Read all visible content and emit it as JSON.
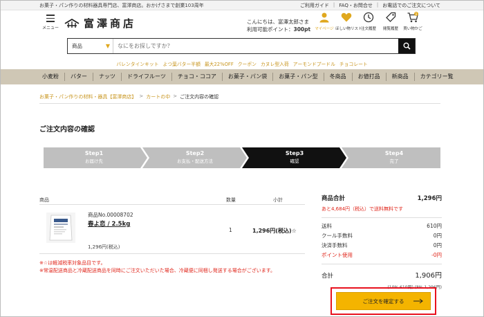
{
  "topbar": {
    "tagline": "お菓子・パン作りの材料器具専門店、富澤商店。おかげさまで創業103周年",
    "links": [
      "ご利用ガイド",
      "FAQ・お問合せ",
      "お電話でのご注文について"
    ]
  },
  "header": {
    "menu_label": "メニュー",
    "logo_text": "富澤商店",
    "greeting": "こんにちは、富澤太郎さま",
    "points_label": "利用可能ポイント：",
    "points_value": "300pt",
    "icons": [
      {
        "name": "user-icon",
        "label": "マイページ"
      },
      {
        "name": "heart-icon",
        "label": "ほしい物リスト"
      },
      {
        "name": "clock-icon",
        "label": "注文履歴"
      },
      {
        "name": "tag-icon",
        "label": "閲覧履歴"
      },
      {
        "name": "cart-icon",
        "label": "買い物かご",
        "badge": "1"
      }
    ]
  },
  "search": {
    "category": "商品",
    "placeholder": "なにをお探しですか？"
  },
  "keywords": [
    "バレンタインキット",
    "よつ葉バター半額",
    "最大22%OFF",
    "クーポン",
    "カヌレ型入荷",
    "アーモンドプードル",
    "チョコレート"
  ],
  "categories": [
    "小麦粉",
    "バター",
    "ナッツ",
    "ドライフルーツ",
    "チョコ・ココア",
    "お菓子・パン袋",
    "お菓子・パン型",
    "冬商品",
    "お値打品",
    "新商品",
    "カテゴリー覧"
  ],
  "breadcrumb": {
    "home": "お菓子・パン作りの材料・器具【富澤商店】",
    "cart": "カートの中",
    "current": "ご注文内容の確認",
    "sep": ">"
  },
  "page_title": "ご注文内容の確認",
  "steps": [
    {
      "num": "Step1",
      "label": "お届け先"
    },
    {
      "num": "Step2",
      "label": "お支払・配送方法"
    },
    {
      "num": "Step3",
      "label": "確認"
    },
    {
      "num": "Step4",
      "label": "完了"
    }
  ],
  "cart": {
    "headers": {
      "product": "商品",
      "qty": "数量",
      "subtotal": "小計"
    },
    "item": {
      "number": "商品No.00008702",
      "name": "春よ恋 / 2.5kg",
      "price": "1,296円(税込)",
      "qty": "1",
      "subtotal": "1,296円(税込)☆"
    },
    "notes": [
      "※☆は軽減税率対象品目です。",
      "※常温配送商品と冷蔵配送商品を同時にご注文いただいた場合、冷蔵便に同梱し発送する場合がございます。"
    ]
  },
  "summary": {
    "total_label": "商品合計",
    "total_value": "1,296円",
    "shipping_notice": "あと4,684円（税込）で送料無料です",
    "rows": [
      {
        "label": "送料",
        "value": "610円"
      },
      {
        "label": "クール手数料",
        "value": "0円"
      },
      {
        "label": "決済手数料",
        "value": "0円"
      },
      {
        "label": "ポイント使用",
        "value": "-0円"
      }
    ],
    "grand_label": "合計",
    "grand_value": "1,906円",
    "tax_breakdown": "(10% 610円) (8% 1,296円)",
    "confirm_button": "ご注文を確定する"
  },
  "colors": {
    "accent": "#F4B400",
    "nav_bg": "#CFC7B5",
    "step_active": "#111111",
    "step_inactive": "#BFBFBF",
    "alert": "#E0261B"
  }
}
